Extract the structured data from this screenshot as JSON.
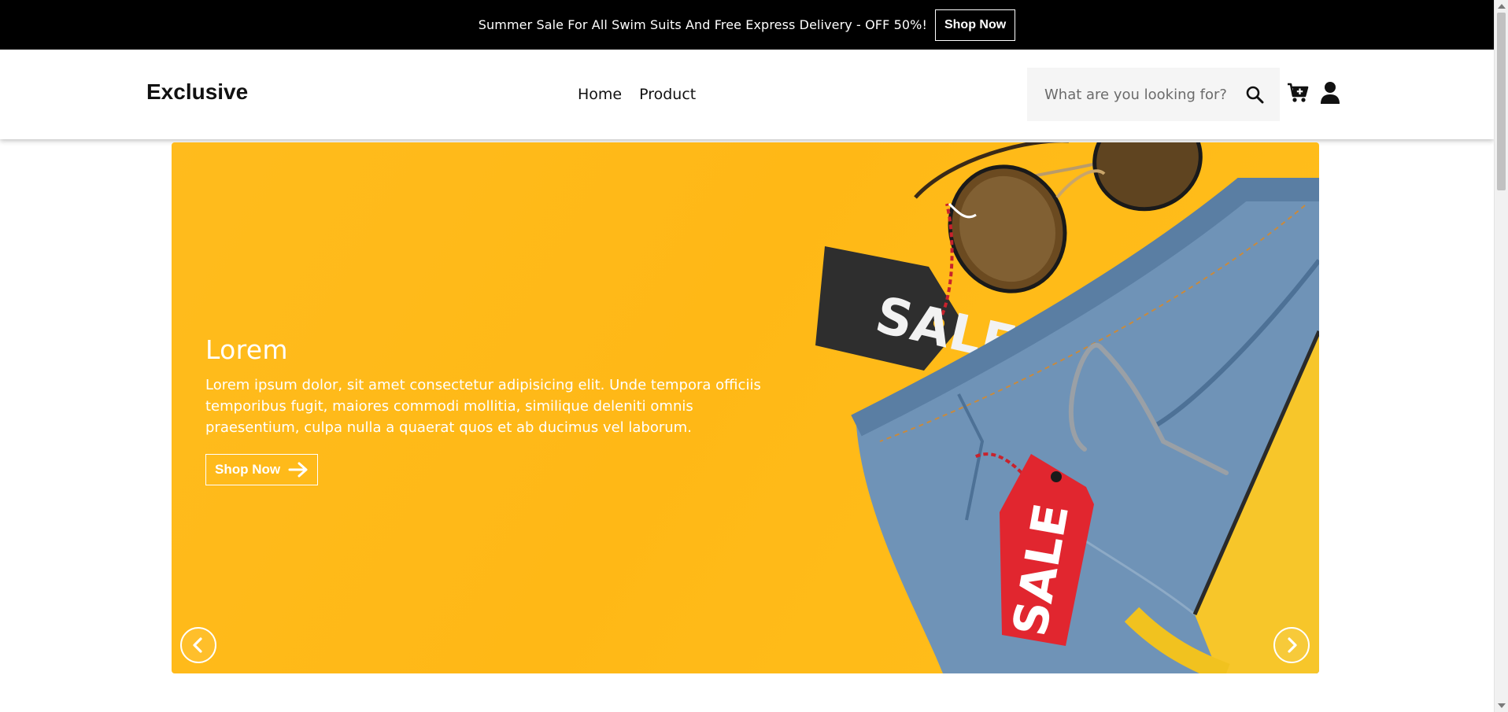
{
  "topbar": {
    "text": "Summer Sale For All Swim Suits And Free Express Delivery - OFF 50%!",
    "button_label": "Shop Now"
  },
  "header": {
    "logo": "Exclusive",
    "nav": [
      "Home",
      "Product"
    ],
    "search_placeholder": "What are you looking for?",
    "icons": [
      "search-icon",
      "cart-icon",
      "user-icon"
    ]
  },
  "hero": {
    "title": "Lorem",
    "text": "Lorem ipsum dolor, sit amet consectetur adipisicing elit. Unde tempora officiis temporibus fugit, maiores commodi mollitia, similique deleniti omnis praesentium, culpa nulla a quaerat quos et ab ducimus vel laborum.",
    "button_label": "Shop Now",
    "image_tags": [
      "SALE",
      "SALE"
    ],
    "background_color": "#ffbb1a"
  }
}
